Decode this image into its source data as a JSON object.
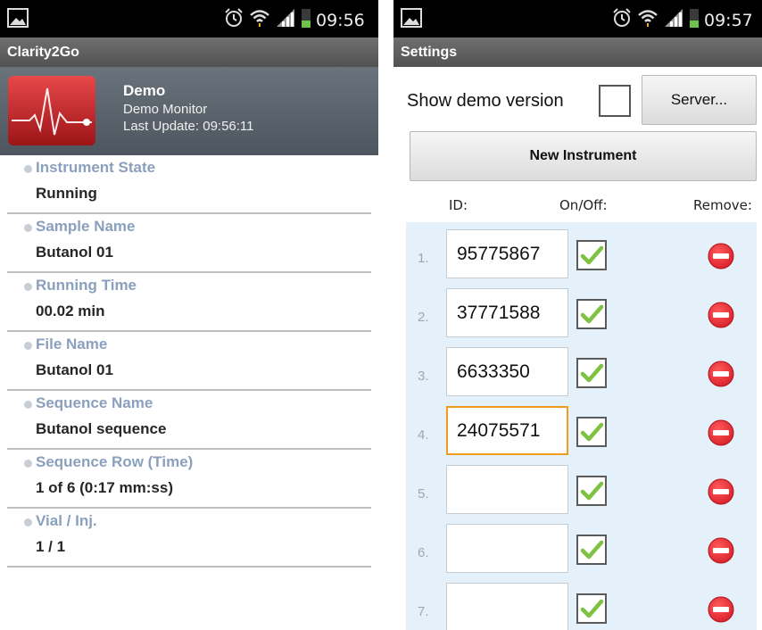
{
  "left_screen": {
    "status_time": "09:56",
    "title": "Clarity2Go",
    "header": {
      "name": "Demo",
      "subtitle": "Demo Monitor",
      "last_update": "Last Update: 09:56:11"
    },
    "items": [
      {
        "label": "Instrument State",
        "value": "Running"
      },
      {
        "label": "Sample Name",
        "value": "Butanol 01"
      },
      {
        "label": "Running Time",
        "value": "00.02 min"
      },
      {
        "label": "File Name",
        "value": "Butanol 01"
      },
      {
        "label": "Sequence Name",
        "value": "Butanol sequence"
      },
      {
        "label": "Sequence Row (Time)",
        "value": "1 of 6 (0:17 mm:ss)"
      },
      {
        "label": "Vial / Inj.",
        "value": "1 / 1"
      }
    ]
  },
  "right_screen": {
    "status_time": "09:57",
    "title": "Settings",
    "show_demo_label": "Show demo version",
    "show_demo_checked": false,
    "server_button": "Server...",
    "new_instrument_button": "New Instrument",
    "columns": {
      "id": "ID:",
      "onoff": "On/Off:",
      "remove": "Remove:"
    },
    "instruments": [
      {
        "num": "1.",
        "id": "95775867",
        "on": true,
        "focused": false
      },
      {
        "num": "2.",
        "id": "37771588",
        "on": true,
        "focused": false
      },
      {
        "num": "3.",
        "id": "6633350",
        "on": true,
        "focused": false
      },
      {
        "num": "4.",
        "id": "24075571",
        "on": true,
        "focused": true
      },
      {
        "num": "5.",
        "id": "",
        "on": true,
        "focused": false
      },
      {
        "num": "6.",
        "id": "",
        "on": true,
        "focused": false
      },
      {
        "num": "7.",
        "id": "",
        "on": true,
        "focused": false
      }
    ]
  },
  "icons": {
    "status_left": "image-icon",
    "alarm": "alarm-clock-icon",
    "wifi": "wifi-icon",
    "signal": "signal-bars-icon",
    "battery": "battery-icon",
    "app": "heartbeat-monitor-icon",
    "check": "checkmark-icon",
    "remove": "remove-minus-icon"
  },
  "colors": {
    "accent_green": "#7fc241",
    "remove_red": "#d9202a",
    "focus_orange": "#f09a1e",
    "label_blue": "#8aa0bd",
    "grid_bg": "#e4f0fa"
  }
}
